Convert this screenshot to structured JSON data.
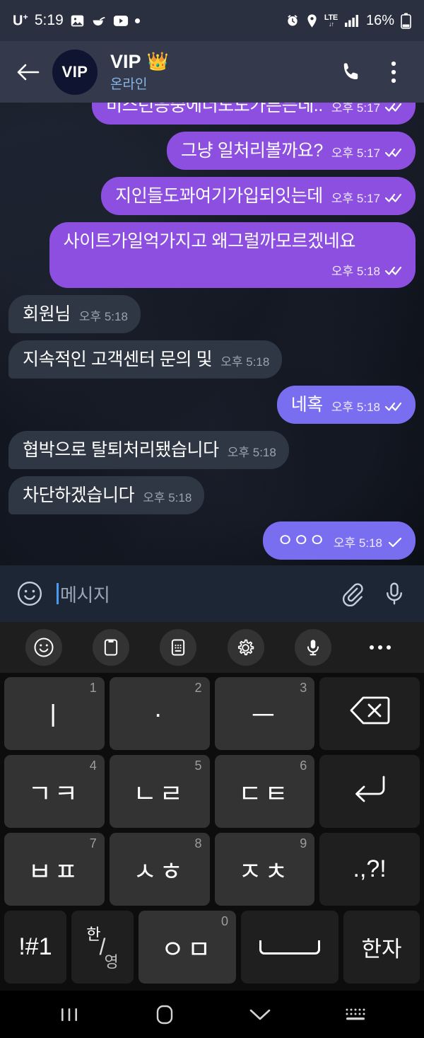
{
  "status_bar": {
    "carrier": "U",
    "carrier_sup": "+",
    "time": "5:19",
    "left_icons": [
      "gallery-icon",
      "noodle-bowl-icon",
      "youtube-icon",
      "dot-icon"
    ],
    "lte_label": "LTE",
    "lte_arrows": "↓↑",
    "battery_percent": "16%",
    "right_icons": [
      "alarm-icon",
      "location-icon",
      "lte-icon",
      "signal-icon",
      "battery-icon"
    ]
  },
  "header": {
    "back_label": "←",
    "avatar_text": "VIP",
    "peer_name": "VIP",
    "crown": "👑",
    "status": "온라인",
    "call_icon": "phone-icon",
    "menu_icon": "more-vertical-icon",
    "status_color": "#86b6e8"
  },
  "chat": {
    "messages": [
      {
        "side": "out",
        "text": "비스런응중에너도도가튼든데..",
        "time": "오후 5:17",
        "ticks": "double",
        "clip": "top"
      },
      {
        "side": "out",
        "text": "그냥 일처리볼까요?",
        "time": "오후 5:17",
        "ticks": "double"
      },
      {
        "side": "out",
        "text": "지인들도꽈여기가입되잇는데",
        "time": "오후 5:17",
        "ticks": "double"
      },
      {
        "side": "out",
        "text": "사이트가일억가지고 왜그럴까모르겠네요",
        "time": "오후 5:18",
        "ticks": "double",
        "wide": true
      },
      {
        "side": "in",
        "text": "회원님",
        "time": "오후 5:18"
      },
      {
        "side": "in",
        "text": "지속적인 고객센터 문의 및",
        "time": "오후 5:18"
      },
      {
        "side": "out",
        "variant": "violet",
        "text": "네혹",
        "time": "오후 5:18",
        "ticks": "double"
      },
      {
        "side": "in",
        "text": "협박으로 탈퇴처리됐습니다",
        "time": "오후 5:18"
      },
      {
        "side": "in",
        "text": "차단하겠습니다",
        "time": "오후 5:18"
      },
      {
        "side": "out",
        "variant": "violet",
        "text": "ㅇㅇㅇ",
        "time": "오후 5:18",
        "ticks": "single"
      },
      {
        "side": "out",
        "variant": "violet",
        "text": "",
        "time": "",
        "clip": "bottom"
      }
    ],
    "outgoing_color": "#8c4fe0",
    "outgoing_violet_color": "#7a6ef0",
    "incoming_color": "#2e3743"
  },
  "input_bar": {
    "emoji_icon": "smiley-icon",
    "placeholder": "메시지",
    "value": "",
    "attach_icon": "paperclip-icon",
    "mic_icon": "microphone-icon"
  },
  "keyboard": {
    "toolbar": [
      {
        "name": "emoji-button",
        "icon": "smiley-icon"
      },
      {
        "name": "clipboard-button",
        "icon": "clipboard-icon"
      },
      {
        "name": "keyboard-mode-button",
        "icon": "keyboard-icon"
      },
      {
        "name": "settings-button",
        "icon": "gear-icon"
      },
      {
        "name": "voice-input-button",
        "icon": "microphone-icon"
      },
      {
        "name": "more-options-button",
        "icon": "ellipsis-icon"
      }
    ],
    "rows": [
      [
        {
          "label": "ㅣ",
          "num": "1",
          "name": "key-i"
        },
        {
          "label": "·",
          "num": "2",
          "name": "key-dot"
        },
        {
          "label": "ㅡ",
          "num": "3",
          "name": "key-eu"
        },
        {
          "label": "",
          "num": "",
          "name": "backspace-key",
          "icon": "backspace-icon",
          "fn": true
        }
      ],
      [
        {
          "label": "ㄱㅋ",
          "num": "4",
          "name": "key-giyeok-kieuk"
        },
        {
          "label": "ㄴㄹ",
          "num": "5",
          "name": "key-nieun-rieul"
        },
        {
          "label": "ㄷㅌ",
          "num": "6",
          "name": "key-digeut-tieut"
        },
        {
          "label": "",
          "num": "",
          "name": "enter-key",
          "icon": "enter-icon",
          "fn": true
        }
      ],
      [
        {
          "label": "ㅂㅍ",
          "num": "7",
          "name": "key-bieup-pieup"
        },
        {
          "label": "ㅅㅎ",
          "num": "8",
          "name": "key-siot-hieut"
        },
        {
          "label": "ㅈㅊ",
          "num": "9",
          "name": "key-jieut-chieut"
        },
        {
          "label": ".,?!",
          "num": "",
          "name": "punctuation-key",
          "fn": true,
          "sym": true
        }
      ]
    ],
    "bottom_row": {
      "symbols_label": "!#1",
      "symbols_name": "symbols-key",
      "lang_top": "한",
      "lang_bottom": "영",
      "lang_name": "language-toggle-key",
      "ieung_label": "ㅇㅁ",
      "ieung_num": "0",
      "ieung_name": "key-ieung-mieum",
      "space_name": "space-key",
      "hanja_label": "한자",
      "hanja_name": "hanja-key"
    }
  },
  "nav_bar": {
    "recents": "recents-icon",
    "home": "home-icon",
    "hide_keyboard": "chevron-down-icon",
    "switch_keyboard": "keyboard-switch-icon"
  }
}
